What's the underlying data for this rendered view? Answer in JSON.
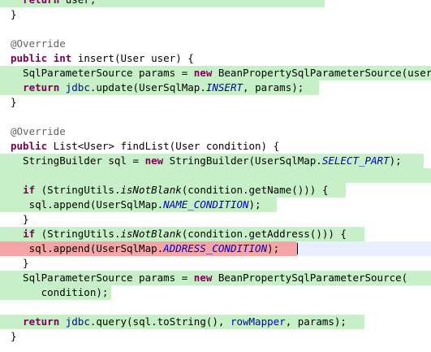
{
  "editor": {
    "language": "java",
    "colors": {
      "added_line_bg": "#c8f0c8",
      "removed_line_bg": "#f4a6a6",
      "current_line_bg": "#e8f0ff",
      "keyword": "#7f0055",
      "annotation": "#646464",
      "field": "#0000c0"
    },
    "lines": [
      {
        "hl": "green",
        "hlEnd": 400,
        "tokens": [
          {
            "t": "  "
          },
          {
            "t": "return",
            "c": "kw"
          },
          {
            "t": " user;"
          }
        ]
      },
      {
        "tokens": [
          {
            "t": "}"
          }
        ]
      },
      {
        "tokens": []
      },
      {
        "tokens": [
          {
            "t": "@Override",
            "c": "ann"
          }
        ]
      },
      {
        "tokens": [
          {
            "t": "public",
            "c": "kw"
          },
          {
            "t": " "
          },
          {
            "t": "int",
            "c": "kw"
          },
          {
            "t": " insert(User user) {"
          }
        ]
      },
      {
        "hl": "green",
        "hlEnd": 531,
        "tokens": [
          {
            "t": "  SqlParameterSource params = "
          },
          {
            "t": "new",
            "c": "kw"
          },
          {
            "t": " BeanPropertySqlParameterSource(user);"
          }
        ]
      },
      {
        "hl": "green",
        "hlEnd": 393,
        "tokens": [
          {
            "t": "  "
          },
          {
            "t": "return",
            "c": "kw"
          },
          {
            "t": " "
          },
          {
            "t": "jdbc",
            "c": "fld"
          },
          {
            "t": ".update(UserSqlMap."
          },
          {
            "t": "INSERT",
            "c": "sfi"
          },
          {
            "t": ", params);"
          }
        ]
      },
      {
        "tokens": [
          {
            "t": "}"
          }
        ]
      },
      {
        "tokens": []
      },
      {
        "tokens": [
          {
            "t": "@Override",
            "c": "ann"
          }
        ]
      },
      {
        "tokens": [
          {
            "t": "public",
            "c": "kw"
          },
          {
            "t": " List<User> findList(User condition) {"
          }
        ]
      },
      {
        "hl": "green",
        "hlEnd": 522,
        "tokens": [
          {
            "t": "  StringBuilder sql = "
          },
          {
            "t": "new",
            "c": "kw"
          },
          {
            "t": " StringBuilder(UserSqlMap."
          },
          {
            "t": "SELECT_PART",
            "c": "sfi"
          },
          {
            "t": ");"
          }
        ]
      },
      {
        "hl": "green",
        "hlEnd": 531,
        "tokens": []
      },
      {
        "hl": "green",
        "hlEnd": 426,
        "tokens": [
          {
            "t": "  "
          },
          {
            "t": "if",
            "c": "kw"
          },
          {
            "t": " (StringUtils."
          },
          {
            "t": "isNotBlank",
            "c": "sm"
          },
          {
            "t": "(condition.getName())) {"
          }
        ]
      },
      {
        "hl": "green",
        "hlEnd": 341,
        "tokens": [
          {
            "t": "   sql.append(UserSqlMap."
          },
          {
            "t": "NAME_CONDITION",
            "c": "sfi"
          },
          {
            "t": ");"
          }
        ]
      },
      {
        "tokens": [
          {
            "t": "  }"
          }
        ]
      },
      {
        "hl": "green",
        "hlEnd": 449,
        "tokens": [
          {
            "t": "  "
          },
          {
            "t": "if",
            "c": "kw"
          },
          {
            "t": " (StringUtils."
          },
          {
            "t": "isNotBlank",
            "c": "sm"
          },
          {
            "t": "(condition.getAddress())) {"
          }
        ]
      },
      {
        "hl": "red",
        "hlEnd": 366,
        "cur": true,
        "caret": 366,
        "tokens": [
          {
            "t": "   sql.append(UserSqlMap."
          },
          {
            "t": "ADDRESS_CONDITION",
            "c": "sfi"
          },
          {
            "t": ");"
          }
        ]
      },
      {
        "tokens": [
          {
            "t": "  }"
          }
        ]
      },
      {
        "hl": "green",
        "hlEnd": 531,
        "tokens": [
          {
            "t": "  SqlParameterSource params = "
          },
          {
            "t": "new",
            "c": "kw"
          },
          {
            "t": " BeanPropertySqlParameterSource("
          }
        ]
      },
      {
        "hl": "green",
        "hlEnd": 137,
        "tokens": [
          {
            "t": "     condition);"
          }
        ]
      },
      {
        "tokens": []
      },
      {
        "hl": "green",
        "hlEnd": 449,
        "tokens": [
          {
            "t": "  "
          },
          {
            "t": "return",
            "c": "kw"
          },
          {
            "t": " "
          },
          {
            "t": "jdbc",
            "c": "fld"
          },
          {
            "t": ".query(sql.toString(), "
          },
          {
            "t": "rowMapper",
            "c": "fld"
          },
          {
            "t": ", params);"
          }
        ]
      },
      {
        "tokens": [
          {
            "t": "}"
          }
        ]
      }
    ]
  }
}
